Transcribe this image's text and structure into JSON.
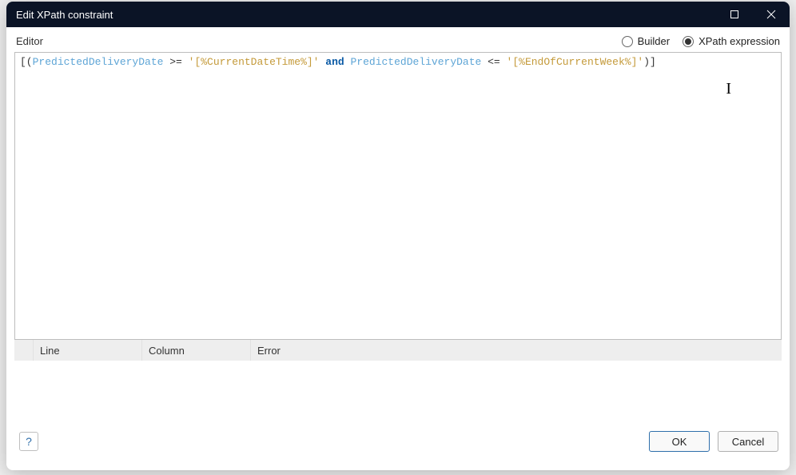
{
  "window": {
    "title": "Edit XPath constraint"
  },
  "editor": {
    "label": "Editor",
    "mode_builder": "Builder",
    "mode_xpath": "XPath expression",
    "selected_mode": "xpath",
    "expression_tokens": [
      {
        "t": "punct",
        "v": "[("
      },
      {
        "t": "attr",
        "v": "PredictedDeliveryDate"
      },
      {
        "t": "op",
        "v": " >= "
      },
      {
        "t": "str",
        "v": "'[%CurrentDateTime%]'"
      },
      {
        "t": "kw",
        "v": " and "
      },
      {
        "t": "attr",
        "v": "PredictedDeliveryDate"
      },
      {
        "t": "op",
        "v": " <= "
      },
      {
        "t": "str",
        "v": "'[%EndOfCurrentWeek%]'"
      },
      {
        "t": "punct",
        "v": ")]"
      }
    ]
  },
  "error_table": {
    "columns": {
      "line": "Line",
      "column": "Column",
      "error": "Error"
    },
    "rows": []
  },
  "footer": {
    "help": "?",
    "ok": "OK",
    "cancel": "Cancel"
  }
}
